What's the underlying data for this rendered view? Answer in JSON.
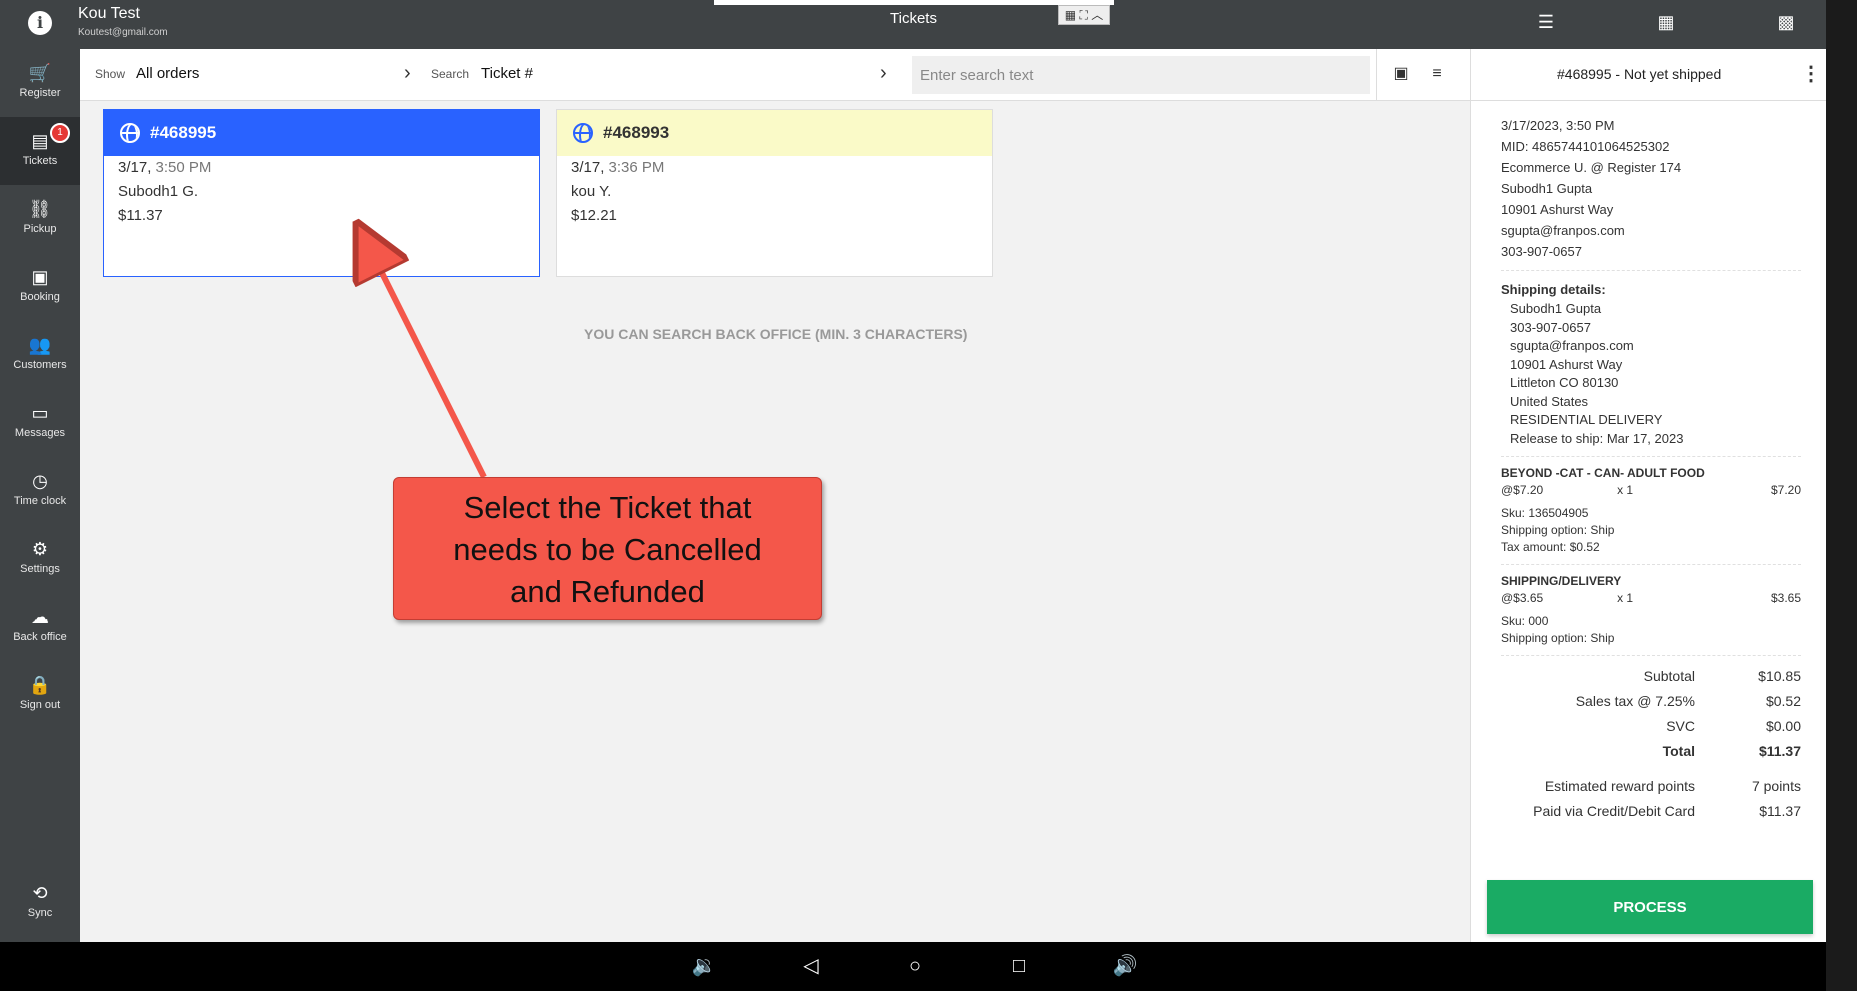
{
  "topbar": {
    "user_name": "Kou Test",
    "user_email": "Koutest@gmail.com",
    "title": "Tickets",
    "mini_ctrl": "▦ ⛶ ︿"
  },
  "sidebar": {
    "items": [
      {
        "label": "Register",
        "icon": "cart-icon",
        "glyph": "🛒"
      },
      {
        "label": "Tickets",
        "icon": "tickets-icon",
        "glyph": "▤",
        "badge": "1"
      },
      {
        "label": "Pickup",
        "icon": "pickup-icon",
        "glyph": "⛓"
      },
      {
        "label": "Booking",
        "icon": "calendar-icon",
        "glyph": "▣"
      },
      {
        "label": "Customers",
        "icon": "people-icon",
        "glyph": "👥"
      },
      {
        "label": "Messages",
        "icon": "message-icon",
        "glyph": "▭"
      },
      {
        "label": "Time clock",
        "icon": "clock-icon",
        "glyph": "◷"
      },
      {
        "label": "Settings",
        "icon": "gear-icon",
        "glyph": "⚙"
      },
      {
        "label": "Back office",
        "icon": "cloud-icon",
        "glyph": "☁"
      },
      {
        "label": "Sign out",
        "icon": "lock-icon",
        "glyph": "🔒"
      }
    ],
    "sync": {
      "label": "Sync",
      "icon": "sync-icon",
      "glyph": "⟲"
    }
  },
  "filter": {
    "show_label": "Show",
    "show_value": "All orders",
    "search_label": "Search",
    "search_value": "Ticket #",
    "search_placeholder": "Enter search text"
  },
  "tickets": [
    {
      "number": "#468995",
      "date": "3/17,",
      "time": " 3:50 PM",
      "customer": "Subodh1 G.",
      "amount": "$11.37",
      "state": "selected"
    },
    {
      "number": "#468993",
      "date": "3/17,",
      "time": " 3:36 PM",
      "customer": "kou Y.",
      "amount": "$12.21",
      "state": "pending"
    }
  ],
  "hint": "YOU CAN SEARCH BACK OFFICE (MIN. 3 CHARACTERS)",
  "callout": {
    "line1": "Select the Ticket that",
    "line2": "needs to be Cancelled",
    "line3": "and Refunded"
  },
  "detail": {
    "header": "#468995 - Not yet shipped",
    "meta": [
      "3/17/2023, 3:50 PM",
      "MID: 4865744101064525302",
      "Ecommerce U. @ Register 174",
      "Subodh1 Gupta",
      "10901 Ashurst Way",
      "sgupta@franpos.com",
      "303-907-0657"
    ],
    "shipping_title": "Shipping details:",
    "shipping": [
      "Subodh1 Gupta",
      "303-907-0657",
      "sgupta@franpos.com",
      "10901 Ashurst Way",
      "Littleton CO 80130",
      "United States",
      "RESIDENTIAL DELIVERY",
      "Release to ship: Mar 17, 2023"
    ],
    "items": [
      {
        "name": "BEYOND -CAT - CAN- ADULT FOOD",
        "unit": "@$7.20",
        "qty": "x  1",
        "total": "$7.20",
        "sku": "Sku: 136504905",
        "ship": "Shipping option: Ship",
        "tax": "Tax amount: $0.52"
      },
      {
        "name": "SHIPPING/DELIVERY",
        "unit": "@$3.65",
        "qty": "x  1",
        "total": "$3.65",
        "sku": "Sku: 000",
        "ship": "Shipping option: Ship"
      }
    ],
    "totals": [
      {
        "label": "Subtotal",
        "value": "$10.85",
        "bold": false
      },
      {
        "label": "Sales tax @ 7.25%",
        "value": "$0.52",
        "bold": false
      },
      {
        "label": "SVC",
        "value": "$0.00",
        "bold": false
      },
      {
        "label": "Total",
        "value": "$11.37",
        "bold": true
      }
    ],
    "reward_label": "Estimated reward points",
    "reward_value": "7 points",
    "paid_label": "Paid via Credit/Debit Card",
    "paid_value": "$11.37",
    "process_label": "PROCESS"
  },
  "colors": {
    "accent_blue": "#2962ff",
    "pending_yellow": "#fafac8",
    "process_green": "#1aab64",
    "callout_red": "#f4574a",
    "bar_dark": "#3f4345"
  }
}
